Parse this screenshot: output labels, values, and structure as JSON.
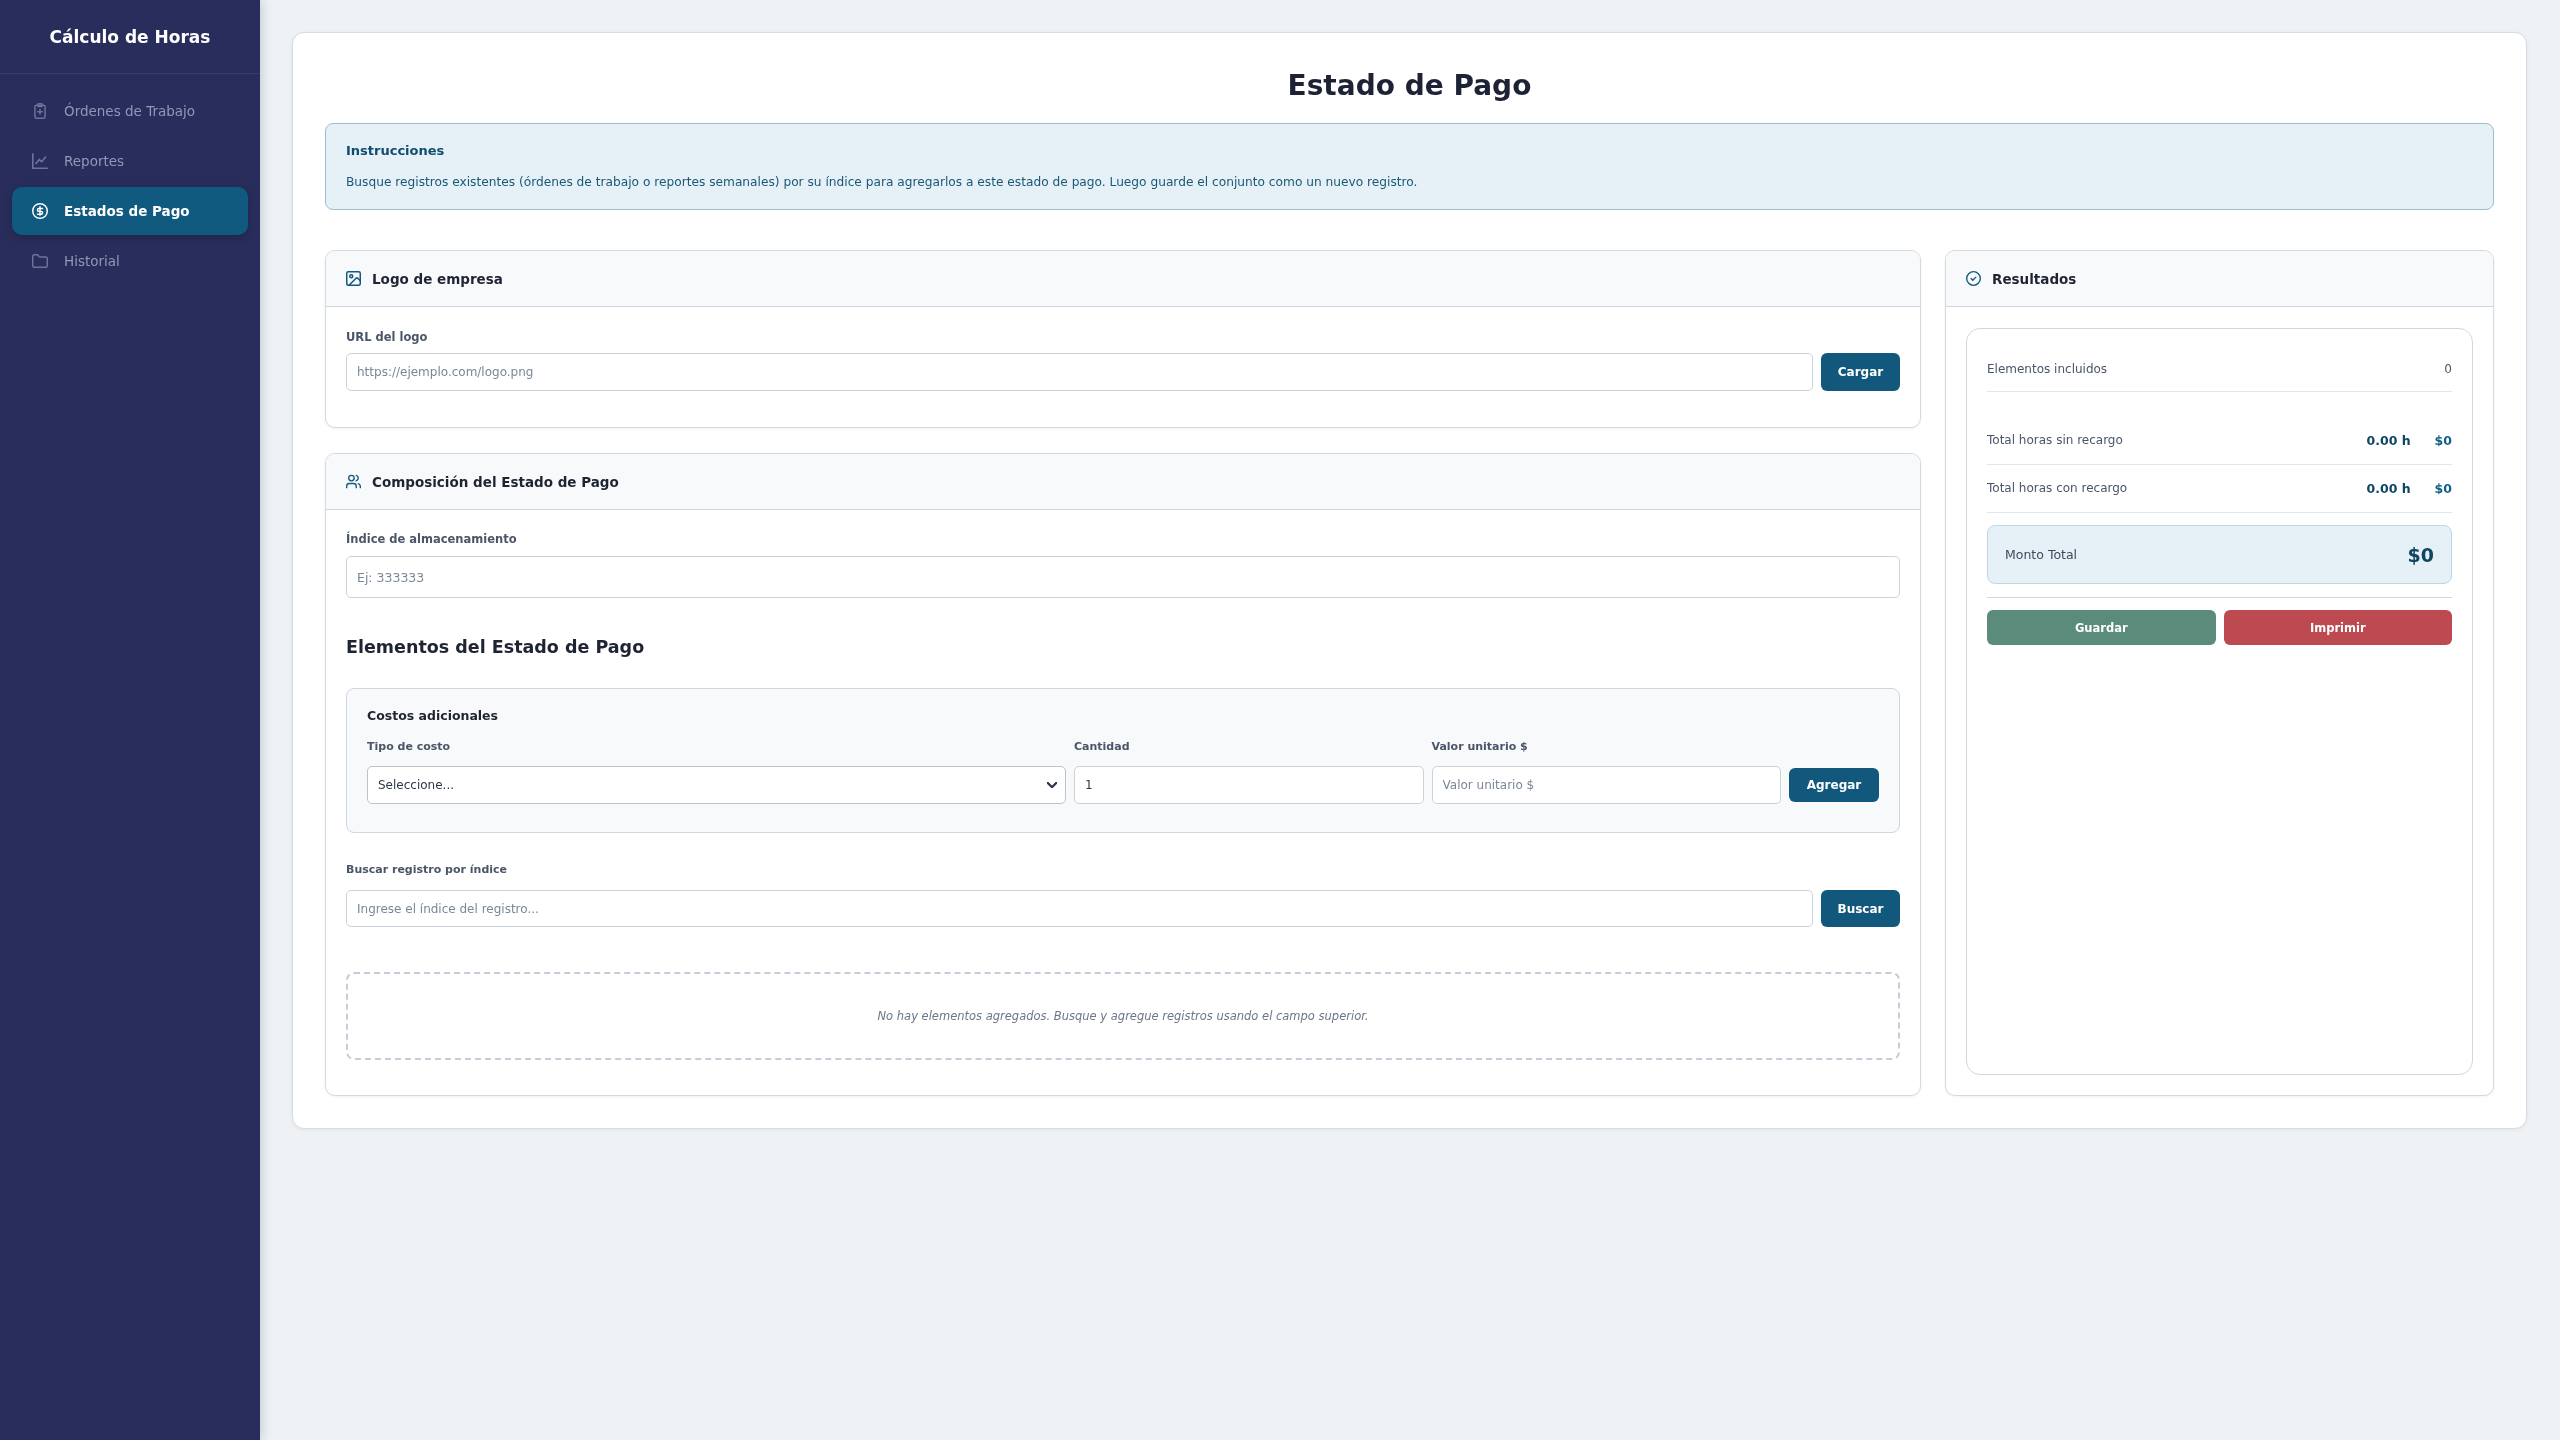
{
  "sidebar": {
    "title": "Cálculo de Horas",
    "items": [
      {
        "label": "Órdenes de Trabajo",
        "selected": false
      },
      {
        "label": "Reportes",
        "selected": false
      },
      {
        "label": "Estados de Pago",
        "selected": true
      },
      {
        "label": "Historial",
        "selected": false
      }
    ]
  },
  "page": {
    "title": "Estado de Pago"
  },
  "instructions": {
    "title": "Instrucciones",
    "text": "Busque registros existentes (órdenes de trabajo o reportes semanales) por su índice para agregarlos a este estado de pago. Luego guarde el conjunto como un nuevo registro."
  },
  "logo_card": {
    "title": "Logo de empresa",
    "url_field": {
      "label": "URL del logo",
      "placeholder": "https://ejemplo.com/logo.png"
    },
    "load_button": "Cargar"
  },
  "composition_card": {
    "title": "Composición del Estado de Pago",
    "index_field": {
      "label": "Índice de almacenamiento",
      "placeholder": "Ej: 333333"
    },
    "elements_heading": "Elementos del Estado de Pago",
    "additional_costs": {
      "title": "Costos adicionales",
      "cost_type": {
        "label": "Tipo de costo",
        "value": "Seleccione..."
      },
      "quantity": {
        "label": "Cantidad",
        "value": "1"
      },
      "unit_value": {
        "label": "Valor unitario $",
        "placeholder": "Valor unitario $"
      },
      "add_button": "Agregar"
    },
    "search_field": {
      "label": "Buscar registro por índice",
      "placeholder": "Ingrese el índice del registro..."
    },
    "search_button": "Buscar",
    "empty_message": "No hay elementos agregados. Busque y agregue registros usando el campo superior."
  },
  "results": {
    "title": "Resultados",
    "included": {
      "label": "Elementos incluidos",
      "value": "0"
    },
    "hour_rows": [
      {
        "label": "Total horas sin recargo",
        "hours": "0.00 h",
        "amount": "$0"
      },
      {
        "label": "Total horas con recargo",
        "hours": "0.00 h",
        "amount": "$0"
      }
    ],
    "total": {
      "label": "Monto Total",
      "value": "$0"
    },
    "buttons": [
      {
        "label": "Guardar",
        "kind": "save"
      },
      {
        "label": "Imprimir",
        "kind": "print"
      }
    ]
  }
}
